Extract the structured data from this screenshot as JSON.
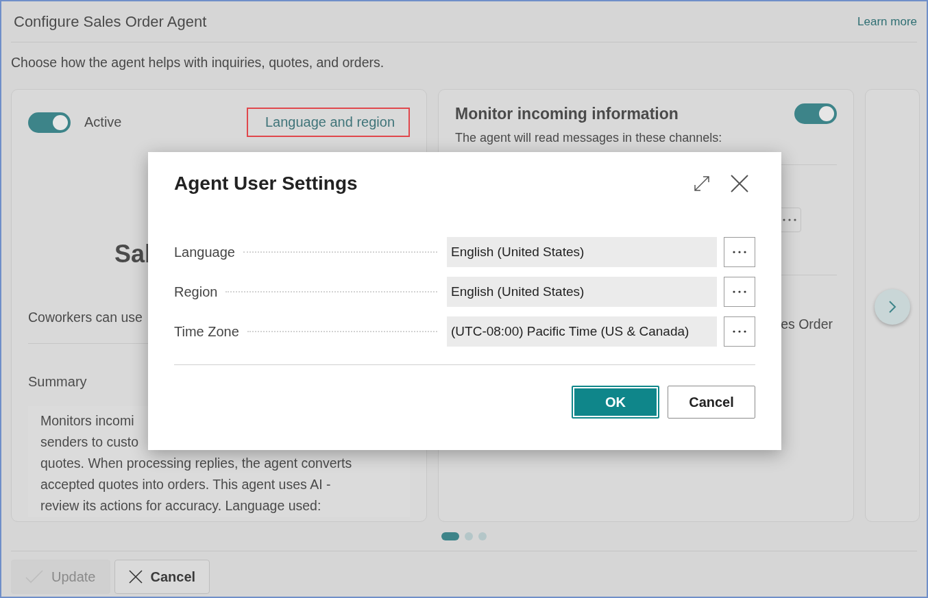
{
  "window": {
    "title": "Configure Sales Order Agent",
    "link": "Learn more",
    "subtitle": "Choose how the agent helps with inquiries, quotes, and orders."
  },
  "cards": [
    {
      "kind": "setup",
      "active": {
        "label": "Active",
        "on": true
      },
      "link": "Language and region",
      "heading": "Sal",
      "description": "Coworkers can use",
      "summary": {
        "label": "Summary",
        "lines": [
          "Monitors incomi",
          "senders to custo",
          "quotes. When processing replies, the agent converts",
          "accepted quotes into orders.  This agent uses AI -",
          "review its actions for accuracy.  Language used:"
        ]
      }
    },
    {
      "kind": "monitor",
      "title": "Monitor incoming information",
      "on": true,
      "text": "The agent will read messages in these channels:",
      "fragment": "es Order"
    },
    {
      "kind": "peek"
    }
  ],
  "carousel": {
    "pages": [
      {
        "selected": true
      },
      {
        "selected": false
      },
      {
        "selected": false
      }
    ]
  },
  "footer": {
    "buttons": [
      {
        "label": "Update",
        "kind": "update",
        "disabled": true
      },
      {
        "label": "Cancel",
        "kind": "cancel",
        "disabled": false
      }
    ]
  },
  "dialog": {
    "title": "Agent User Settings",
    "fields": [
      {
        "label": "Language",
        "value": "English (United States)"
      },
      {
        "label": "Region",
        "value": "English (United States)"
      },
      {
        "label": "Time Zone",
        "value": "(UTC-08:00) Pacific Time (US & Canada)"
      }
    ],
    "buttons": [
      {
        "label": "OK",
        "kind": "primary"
      },
      {
        "label": "Cancel",
        "kind": "secondary"
      }
    ]
  }
}
